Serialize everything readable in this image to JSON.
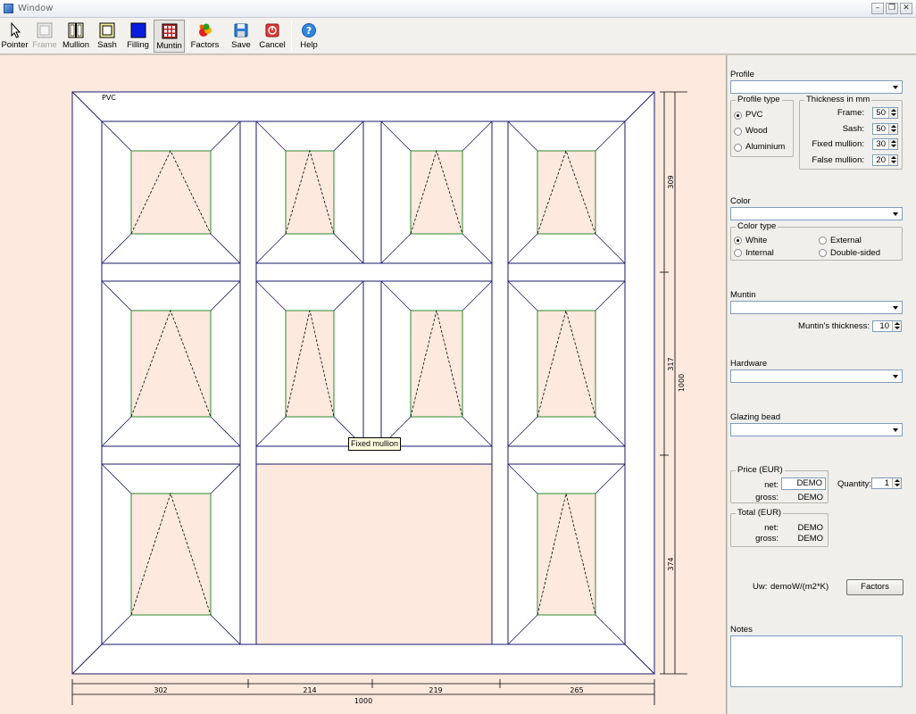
{
  "window": {
    "title": "Window",
    "controls": [
      "–",
      "❐",
      "✕"
    ]
  },
  "toolbar": {
    "pointer": "Pointer",
    "frame": "Frame",
    "mullion": "Mullion",
    "sash": "Sash",
    "filling": "Filling",
    "muntin": "Muntin",
    "factors": "Factors",
    "save": "Save",
    "cancel": "Cancel",
    "help": "Help"
  },
  "canvas": {
    "material_label": "PVC",
    "tooltip": "Fixed mullion",
    "dims_bottom": [
      "302",
      "214",
      "219",
      "265"
    ],
    "dim_total_width": "1000",
    "dims_right": [
      "309",
      "317",
      "374"
    ],
    "dim_total_height": "1000"
  },
  "panel": {
    "profile": {
      "label": "Profile",
      "selected": "",
      "profile_type": {
        "title": "Profile type",
        "options": [
          "PVC",
          "Wood",
          "Aluminium"
        ],
        "selected_index": 0
      },
      "thickness": {
        "title": "Thickness in mm",
        "frame_label": "Frame:",
        "frame_value": "50",
        "sash_label": "Sash:",
        "sash_value": "50",
        "fixed_mullion_label": "Fixed mullion:",
        "fixed_mullion_value": "30",
        "false_mullion_label": "False mullion:",
        "false_mullion_value": "20"
      }
    },
    "color": {
      "label": "Color",
      "selected": "",
      "color_type": {
        "title": "Color type",
        "white": "White",
        "external": "External",
        "internal": "Internal",
        "double_sided": "Double-sided"
      }
    },
    "muntin": {
      "label": "Muntin",
      "selected": "",
      "thickness_label": "Muntin's thickness:",
      "thickness_value": "10"
    },
    "hardware": {
      "label": "Hardware",
      "selected": ""
    },
    "glazing_bead": {
      "label": "Glazing bead",
      "selected": ""
    },
    "price": {
      "title": "Price (EUR)",
      "net_label": "net:",
      "net_value": "DEMO",
      "gross_label": "gross:",
      "gross_value": "DEMO"
    },
    "quantity": {
      "label": "Quantity:",
      "value": "1"
    },
    "total": {
      "title": "Total (EUR)",
      "net_label": "net:",
      "net_value": "DEMO",
      "gross_label": "gross:",
      "gross_value": "DEMO"
    },
    "uw": {
      "label": "Uw:",
      "value": "demo",
      "unit": "W/(m2*K)"
    },
    "factors_button": "Factors",
    "notes": {
      "label": "Notes",
      "value": ""
    }
  }
}
